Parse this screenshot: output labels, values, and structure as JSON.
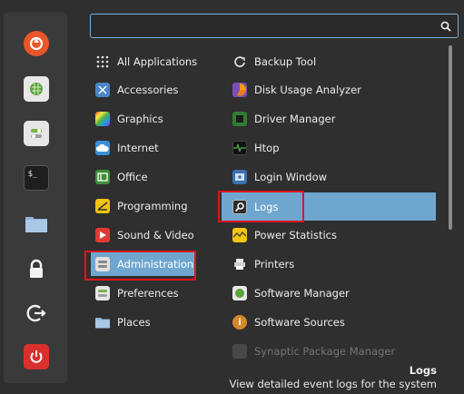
{
  "favorites": [
    {
      "name": "firefox-icon"
    },
    {
      "name": "software-manager-icon"
    },
    {
      "name": "settings-icon"
    },
    {
      "name": "terminal-icon"
    },
    {
      "name": "files-icon"
    },
    {
      "name": "lock-screen-icon"
    },
    {
      "name": "logout-icon"
    },
    {
      "name": "power-icon"
    }
  ],
  "search": {
    "value": "",
    "placeholder": ""
  },
  "categories": [
    {
      "label": "All Applications"
    },
    {
      "label": "Accessories"
    },
    {
      "label": "Graphics"
    },
    {
      "label": "Internet"
    },
    {
      "label": "Office"
    },
    {
      "label": "Programming"
    },
    {
      "label": "Sound & Video"
    },
    {
      "label": "Administration",
      "highlighted": true
    },
    {
      "label": "Preferences"
    },
    {
      "label": "Places"
    }
  ],
  "apps": [
    {
      "label": "Backup Tool"
    },
    {
      "label": "Disk Usage Analyzer"
    },
    {
      "label": "Driver Manager"
    },
    {
      "label": "Htop"
    },
    {
      "label": "Login Window"
    },
    {
      "label": "Logs",
      "selected": true,
      "highlighted": true
    },
    {
      "label": "Power Statistics"
    },
    {
      "label": "Printers"
    },
    {
      "label": "Software Manager"
    },
    {
      "label": "Software Sources"
    },
    {
      "label": "Synaptic Package Manager"
    }
  ],
  "footer": {
    "title": "Logs",
    "description": "View detailed event logs for the system"
  },
  "colors": {
    "selection": "#6ea6cf",
    "highlight_box": "#e0141e",
    "search_border": "#7fb0d8"
  }
}
